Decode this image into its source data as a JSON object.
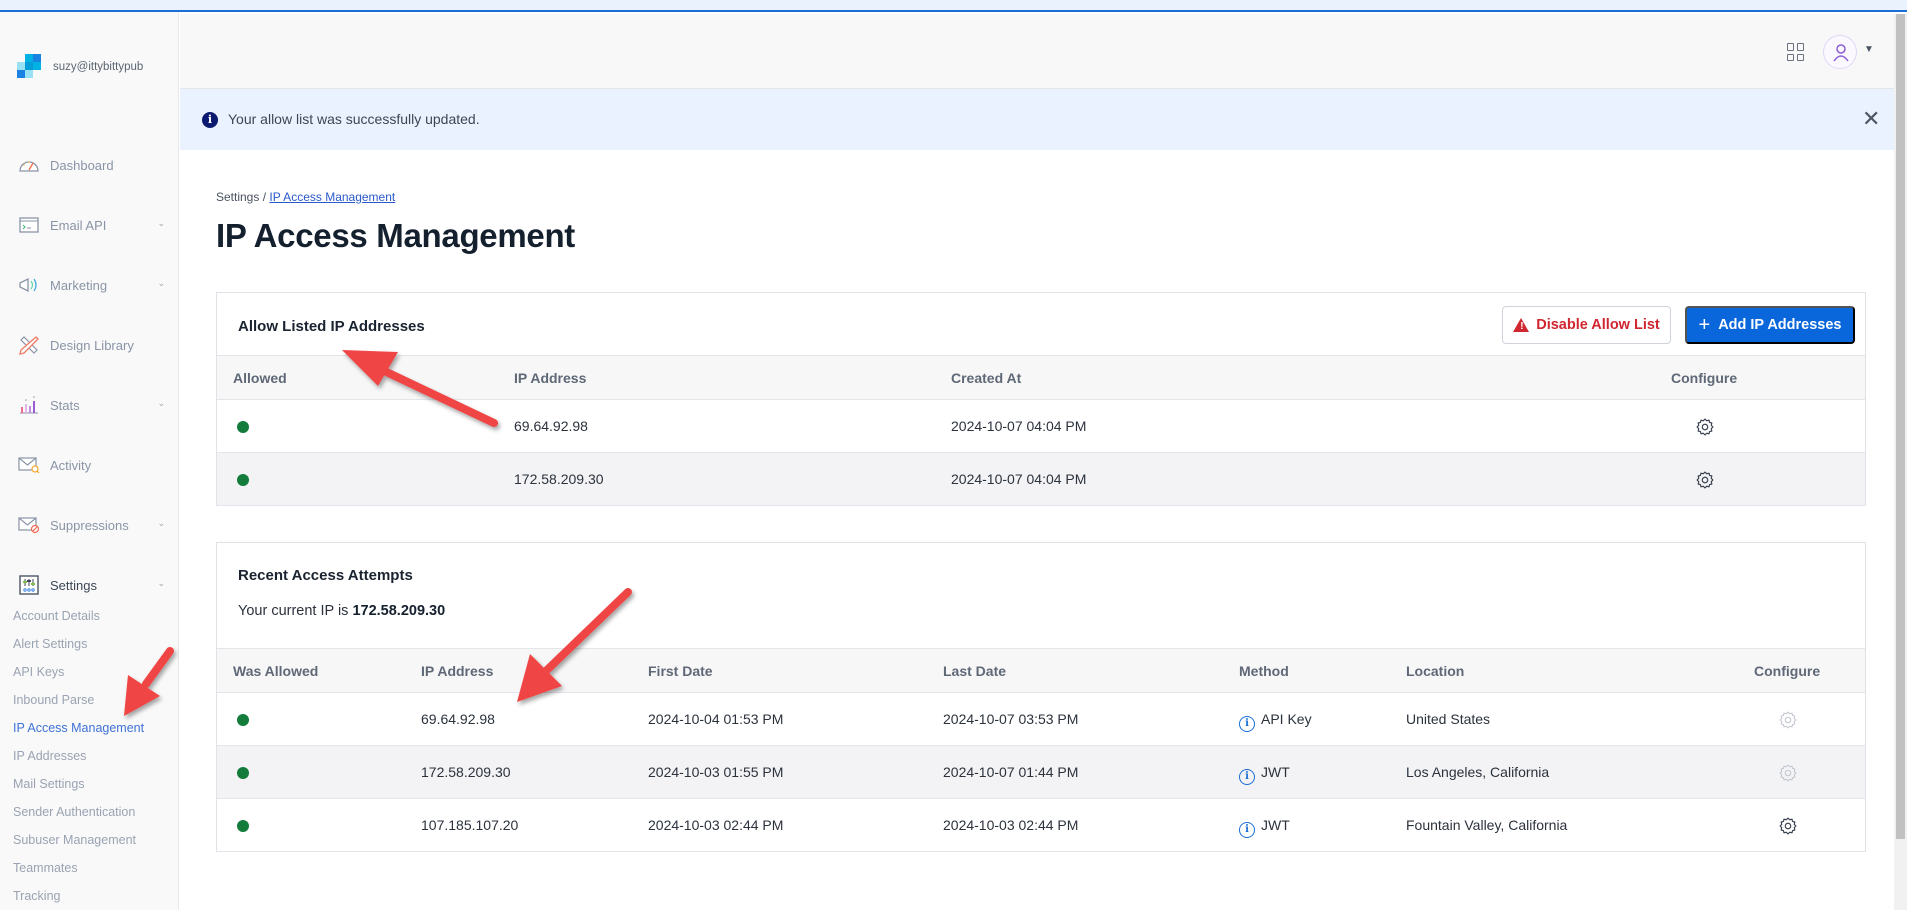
{
  "account": {
    "email": "suzy@ittybittypub"
  },
  "sidebar": {
    "items": [
      {
        "label": "Dashboard",
        "icon": "dashboard-gauge-icon",
        "has_chevron": false
      },
      {
        "label": "Email API",
        "icon": "terminal-window-icon",
        "has_chevron": true
      },
      {
        "label": "Marketing",
        "icon": "megaphone-icon",
        "has_chevron": true
      },
      {
        "label": "Design Library",
        "icon": "pencil-ruler-icon",
        "has_chevron": false
      },
      {
        "label": "Stats",
        "icon": "bar-chart-icon",
        "has_chevron": true
      },
      {
        "label": "Activity",
        "icon": "envelope-search-icon",
        "has_chevron": false
      },
      {
        "label": "Suppressions",
        "icon": "envelope-block-icon",
        "has_chevron": true
      },
      {
        "label": "Settings",
        "icon": "sliders-icon",
        "has_chevron": true,
        "expanded": true
      }
    ],
    "settings_subitems": [
      {
        "label": "Account Details",
        "active": false
      },
      {
        "label": "Alert Settings",
        "active": false
      },
      {
        "label": "API Keys",
        "active": false
      },
      {
        "label": "Inbound Parse",
        "active": false
      },
      {
        "label": "IP Access Management",
        "active": true
      },
      {
        "label": "IP Addresses",
        "active": false
      },
      {
        "label": "Mail Settings",
        "active": false
      },
      {
        "label": "Sender Authentication",
        "active": false
      },
      {
        "label": "Subuser Management",
        "active": false
      },
      {
        "label": "Teammates",
        "active": false
      },
      {
        "label": "Tracking",
        "active": false
      }
    ]
  },
  "header": {
    "apps_icon": "grid-apps-icon",
    "avatar_icon": "user-icon"
  },
  "banner": {
    "message": "Your allow list was successfully updated.",
    "icon": "info-icon",
    "close_glyph": "✕"
  },
  "breadcrumb": {
    "parent": "Settings",
    "separator": "/",
    "current": "IP Access Management"
  },
  "page_title": "IP Access Management",
  "allow_list": {
    "title": "Allow Listed IP Addresses",
    "disable_button": "Disable Allow List",
    "add_button": "Add IP Addresses",
    "columns": [
      "Allowed",
      "IP Address",
      "Created At",
      "Configure"
    ],
    "rows": [
      {
        "allowed": true,
        "ip": "69.64.92.98",
        "created_at": "2024-10-07 04:04 PM"
      },
      {
        "allowed": true,
        "ip": "172.58.209.30",
        "created_at": "2024-10-07 04:04 PM"
      }
    ]
  },
  "recent_attempts": {
    "title": "Recent Access Attempts",
    "current_ip_label": "Your current IP is",
    "current_ip": "172.58.209.30",
    "columns": [
      "Was Allowed",
      "IP Address",
      "First Date",
      "Last Date",
      "Method",
      "Location",
      "Configure"
    ],
    "rows": [
      {
        "allowed": true,
        "ip": "69.64.92.98",
        "first_date": "2024-10-04 01:53 PM",
        "last_date": "2024-10-07 03:53 PM",
        "method": "API Key",
        "location": "United States",
        "configure_enabled": false
      },
      {
        "allowed": true,
        "ip": "172.58.209.30",
        "first_date": "2024-10-03 01:55 PM",
        "last_date": "2024-10-07 01:44 PM",
        "method": "JWT",
        "location": "Los Angeles, California",
        "configure_enabled": false
      },
      {
        "allowed": true,
        "ip": "107.185.107.20",
        "first_date": "2024-10-03 02:44 PM",
        "last_date": "2024-10-03 02:44 PM",
        "method": "JWT",
        "location": "Fountain Valley, California",
        "configure_enabled": true
      }
    ]
  },
  "colors": {
    "primary": "#0a66db",
    "danger": "#d0262f",
    "allowed_dot": "#137b3b",
    "active_link": "#3d72d6",
    "annotation_arrow": "#ef4444"
  }
}
